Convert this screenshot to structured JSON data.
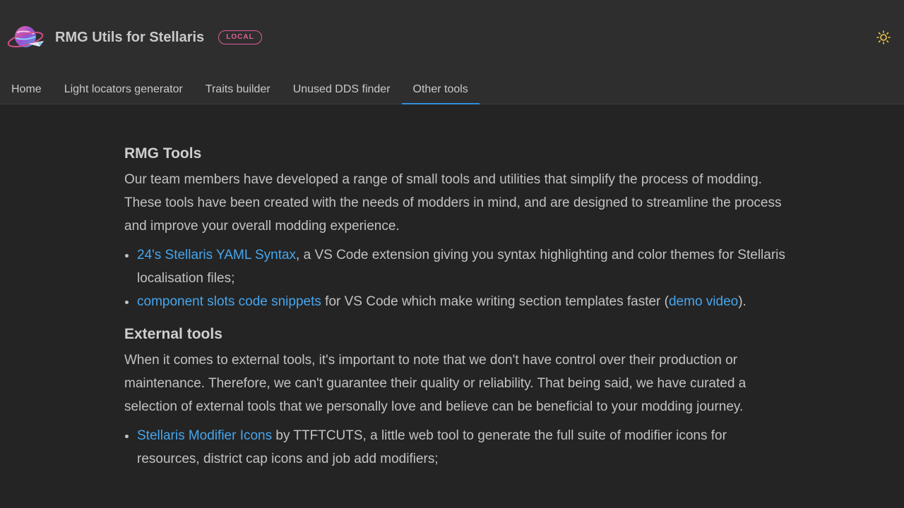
{
  "header": {
    "title": "RMG Utils for Stellaris",
    "badge": "LOCAL",
    "logo_icon": "planet-rocket-logo-icon",
    "theme_icon": "sun-icon",
    "accent_color": "#2f8fde",
    "badge_color": "#e0609a"
  },
  "tabs": [
    {
      "label": "Home"
    },
    {
      "label": "Light locators generator"
    },
    {
      "label": "Traits builder"
    },
    {
      "label": "Unused DDS finder"
    },
    {
      "label": "Other tools",
      "active": true
    }
  ],
  "rmg_section": {
    "heading": "RMG Tools",
    "intro": "Our team members have developed a range of small tools and utilities that simplify the process of modding. These tools have been created with the needs of modders in mind, and are designed to streamline the process and improve your overall modding experience.",
    "items": [
      {
        "link": "24's Stellaris YAML Syntax",
        "text": ", a VS Code extension giving you syntax highlighting and color themes for Stellaris localisation files;"
      },
      {
        "link": "component slots code snippets",
        "text": " for VS Code which make writing section templates faster (",
        "link2": "demo video",
        "text2": ")."
      }
    ]
  },
  "external_section": {
    "heading": "External tools",
    "intro": "When it comes to external tools, it's important to note that we don't have control over their production or maintenance. Therefore, we can't guarantee their quality or reliability. That being said, we have curated a selection of external tools that we personally love and believe can be beneficial to your modding journey.",
    "items": [
      {
        "link": "Stellaris Modifier Icons",
        "text": " by TTFTCUTS, a little web tool to generate the full suite of modifier icons for resources, district cap icons and job add modifiers;"
      }
    ]
  },
  "link_color": "#46a6ee"
}
